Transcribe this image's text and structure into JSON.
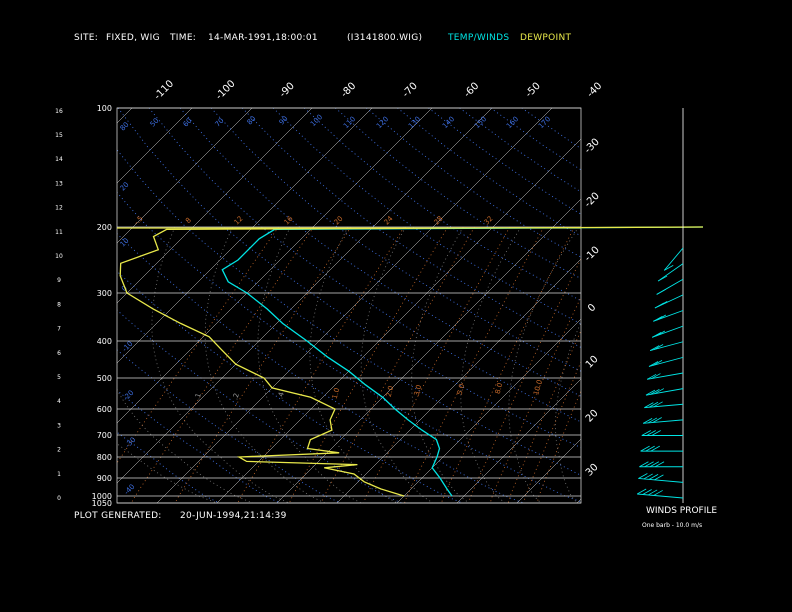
{
  "header": {
    "site_label": "SITE:",
    "site_value": "FIXED, WIG",
    "time_label": "TIME:",
    "time_value": "14-MAR-1991,18:00:01",
    "file": "(I3141800.WIG)",
    "legend_temp": "TEMP/WINDS",
    "legend_dew": "DEWPOINT"
  },
  "footer": {
    "generated_label": "PLOT GENERATED:",
    "generated_value": "20-JUN-1994,21:14:39"
  },
  "winds_title": "WINDS PROFILE",
  "winds_note": "One barb - 10.0 m/s",
  "colors": {
    "temperature": "#00e5e5",
    "dewpoint": "#e8e84a",
    "isobar": "#d9d9d9",
    "isotherm": "#d9d9d9",
    "dry_adiabat": "#3d6ee0",
    "moist_adiabat": "#7a7a7a",
    "mixing_ratio": "#c86a2a",
    "tropopause": "#e8e84a"
  },
  "chart_data": {
    "type": "line",
    "subtype": "skew-T log-P sounding",
    "pressure_levels": [
      100,
      200,
      300,
      400,
      500,
      600,
      700,
      800,
      900,
      1000,
      1050
    ],
    "height_ticks_km": [
      0,
      1,
      2,
      3,
      4,
      5,
      6,
      7,
      8,
      9,
      10,
      11,
      12,
      13,
      14,
      15,
      16
    ],
    "isotherm_labels_top": [
      "-110",
      "-100",
      "-90",
      "-80",
      "-70",
      "-60",
      "-50",
      "-40"
    ],
    "isotherm_labels_right": [
      "-30",
      "-20",
      "-10",
      "0",
      "10",
      "20",
      "30"
    ],
    "dry_adiabat_labels": [
      "80",
      "50",
      "60",
      "70",
      "80",
      "90",
      "100",
      "110",
      "120",
      "130",
      "140",
      "150",
      "160",
      "170",
      "20",
      "10",
      "0",
      "-10",
      "-20",
      "-30",
      "-40"
    ],
    "mixing_ratio_labels": [
      "-.5",
      "8",
      "12",
      "16",
      "20",
      "24",
      "28",
      "32"
    ],
    "mixing_ratio_lower_labels": [
      ".1",
      ".2",
      ".4",
      "1.0",
      "2.0",
      "3.0",
      "5.0",
      "8.0",
      "10.0"
    ],
    "series": [
      {
        "name": "TEMP/WINDS",
        "points": [
          {
            "p": 1000,
            "t": 18
          },
          {
            "p": 960,
            "t": 16
          },
          {
            "p": 900,
            "t": 13
          },
          {
            "p": 850,
            "t": 10
          },
          {
            "p": 800,
            "t": 9
          },
          {
            "p": 760,
            "t": 8
          },
          {
            "p": 720,
            "t": 6
          },
          {
            "p": 680,
            "t": 2
          },
          {
            "p": 640,
            "t": -2
          },
          {
            "p": 600,
            "t": -6
          },
          {
            "p": 560,
            "t": -10
          },
          {
            "p": 520,
            "t": -15
          },
          {
            "p": 480,
            "t": -20
          },
          {
            "p": 440,
            "t": -26
          },
          {
            "p": 400,
            "t": -32
          },
          {
            "p": 360,
            "t": -39
          },
          {
            "p": 330,
            "t": -44
          },
          {
            "p": 300,
            "t": -50
          },
          {
            "p": 280,
            "t": -55
          },
          {
            "p": 260,
            "t": -58
          },
          {
            "p": 245,
            "t": -57
          },
          {
            "p": 230,
            "t": -57
          },
          {
            "p": 215,
            "t": -57
          },
          {
            "p": 203,
            "t": -56
          },
          {
            "p": 200,
            "t": 15
          }
        ]
      },
      {
        "name": "DEWPOINT",
        "points": [
          {
            "p": 1000,
            "t": 10
          },
          {
            "p": 960,
            "t": 5
          },
          {
            "p": 920,
            "t": 1
          },
          {
            "p": 880,
            "t": -2
          },
          {
            "p": 850,
            "t": -8
          },
          {
            "p": 835,
            "t": -3
          },
          {
            "p": 820,
            "t": -22
          },
          {
            "p": 800,
            "t": -24
          },
          {
            "p": 780,
            "t": -8
          },
          {
            "p": 760,
            "t": -14
          },
          {
            "p": 720,
            "t": -15
          },
          {
            "p": 680,
            "t": -13
          },
          {
            "p": 640,
            "t": -15
          },
          {
            "p": 600,
            "t": -16
          },
          {
            "p": 560,
            "t": -22
          },
          {
            "p": 530,
            "t": -30
          },
          {
            "p": 500,
            "t": -33
          },
          {
            "p": 460,
            "t": -40
          },
          {
            "p": 420,
            "t": -45
          },
          {
            "p": 390,
            "t": -49
          },
          {
            "p": 360,
            "t": -56
          },
          {
            "p": 330,
            "t": -63
          },
          {
            "p": 300,
            "t": -70
          },
          {
            "p": 270,
            "t": -74
          },
          {
            "p": 250,
            "t": -76
          },
          {
            "p": 230,
            "t": -72
          },
          {
            "p": 212,
            "t": -75
          },
          {
            "p": 203,
            "t": -74
          },
          {
            "p": 200,
            "t": 15
          }
        ]
      }
    ],
    "winds_profile": [
      {
        "level": 1,
        "dir": 220,
        "speed": 12
      },
      {
        "level": 2,
        "dir": 235,
        "speed": 14
      },
      {
        "level": 3,
        "dir": 240,
        "speed": 14
      },
      {
        "level": 4,
        "dir": 245,
        "speed": 15
      },
      {
        "level": 5,
        "dir": 250,
        "speed": 16
      },
      {
        "level": 6,
        "dir": 250,
        "speed": 18
      },
      {
        "level": 7,
        "dir": 255,
        "speed": 20
      },
      {
        "level": 8,
        "dir": 255,
        "speed": 22
      },
      {
        "level": 9,
        "dir": 260,
        "speed": 24
      },
      {
        "level": 10,
        "dir": 260,
        "speed": 26
      },
      {
        "level": 11,
        "dir": 265,
        "speed": 28
      },
      {
        "level": 12,
        "dir": 265,
        "speed": 30
      },
      {
        "level": 13,
        "dir": 270,
        "speed": 32
      },
      {
        "level": 14,
        "dir": 270,
        "speed": 34
      },
      {
        "level": 15,
        "dir": 270,
        "speed": 36
      },
      {
        "level": 16,
        "dir": 275,
        "speed": 38
      },
      {
        "level": 17,
        "dir": 275,
        "speed": 40
      }
    ]
  }
}
